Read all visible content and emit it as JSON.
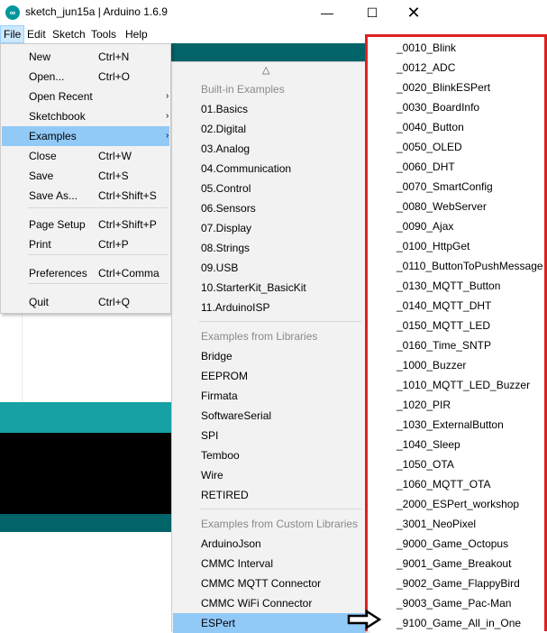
{
  "window": {
    "title": "sketch_jun15a | Arduino 1.6.9",
    "app_icon": "arduino-logo-icon",
    "minimize_glyph": "—",
    "maximize_glyph": "☐",
    "close_glyph": "✕"
  },
  "menubar": [
    "File",
    "Edit",
    "Sketch",
    "Tools",
    "Help"
  ],
  "file_menu": {
    "items": [
      {
        "label": "New",
        "shortcut": "Ctrl+N"
      },
      {
        "label": "Open...",
        "shortcut": "Ctrl+O"
      },
      {
        "label": "Open Recent",
        "shortcut": "",
        "arrow": "›"
      },
      {
        "label": "Sketchbook",
        "shortcut": "",
        "arrow": "›"
      },
      {
        "label": "Examples",
        "shortcut": "",
        "arrow": "›",
        "selected": true
      },
      {
        "label": "Close",
        "shortcut": "Ctrl+W"
      },
      {
        "label": "Save",
        "shortcut": "Ctrl+S"
      },
      {
        "label": "Save As...",
        "shortcut": "Ctrl+Shift+S"
      },
      {
        "label": "Page Setup",
        "shortcut": "Ctrl+Shift+P"
      },
      {
        "label": "Print",
        "shortcut": "Ctrl+P"
      },
      {
        "label": "Preferences",
        "shortcut": "Ctrl+Comma"
      },
      {
        "label": "Quit",
        "shortcut": "Ctrl+Q"
      }
    ]
  },
  "examples_menu": {
    "scroll_up": "△",
    "builtin_header": "Built-in Examples",
    "builtin": [
      "01.Basics",
      "02.Digital",
      "03.Analog",
      "04.Communication",
      "05.Control",
      "06.Sensors",
      "07.Display",
      "08.Strings",
      "09.USB",
      "10.StarterKit_BasicKit",
      "11.ArduinoISP"
    ],
    "libraries_header": "Examples from Libraries",
    "libraries": [
      "Bridge",
      "EEPROM",
      "Firmata",
      "SoftwareSerial",
      "SPI",
      "Temboo",
      "Wire",
      "RETIRED"
    ],
    "custom_header": "Examples from Custom Libraries",
    "custom": [
      "ArduinoJson",
      "CMMC Interval",
      "CMMC MQTT Connector",
      "CMMC WiFi Connector",
      "ESPert"
    ],
    "selected": "ESPert"
  },
  "espert_menu": {
    "items": [
      "_0010_Blink",
      "_0012_ADC",
      "_0020_BlinkESPert",
      "_0030_BoardInfo",
      "_0040_Button",
      "_0050_OLED",
      "_0060_DHT",
      "_0070_SmartConfig",
      "_0080_WebServer",
      "_0090_Ajax",
      "_0100_HttpGet",
      "_0110_ButtonToPushMessage",
      "_0130_MQTT_Button",
      "_0140_MQTT_DHT",
      "_0150_MQTT_LED",
      "_0160_Time_SNTP",
      "_1000_Buzzer",
      "_1010_MQTT_LED_Buzzer",
      "_1020_PIR",
      "_1030_ExternalButton",
      "_1040_Sleep",
      "_1050_OTA",
      "_1060_MQTT_OTA",
      "_2000_ESPert_workshop",
      "_3001_NeoPixel",
      "_9000_Game_Octopus",
      "_9001_Game_Breakout",
      "_9002_Game_FlappyBird",
      "_9003_Game_Pac-Man",
      "_9100_Game_All_in_One"
    ]
  },
  "colors": {
    "highlight_border": "#e02020",
    "selection": "#91c9f7",
    "teal": "#006468",
    "teal_light": "#17a1a5"
  }
}
